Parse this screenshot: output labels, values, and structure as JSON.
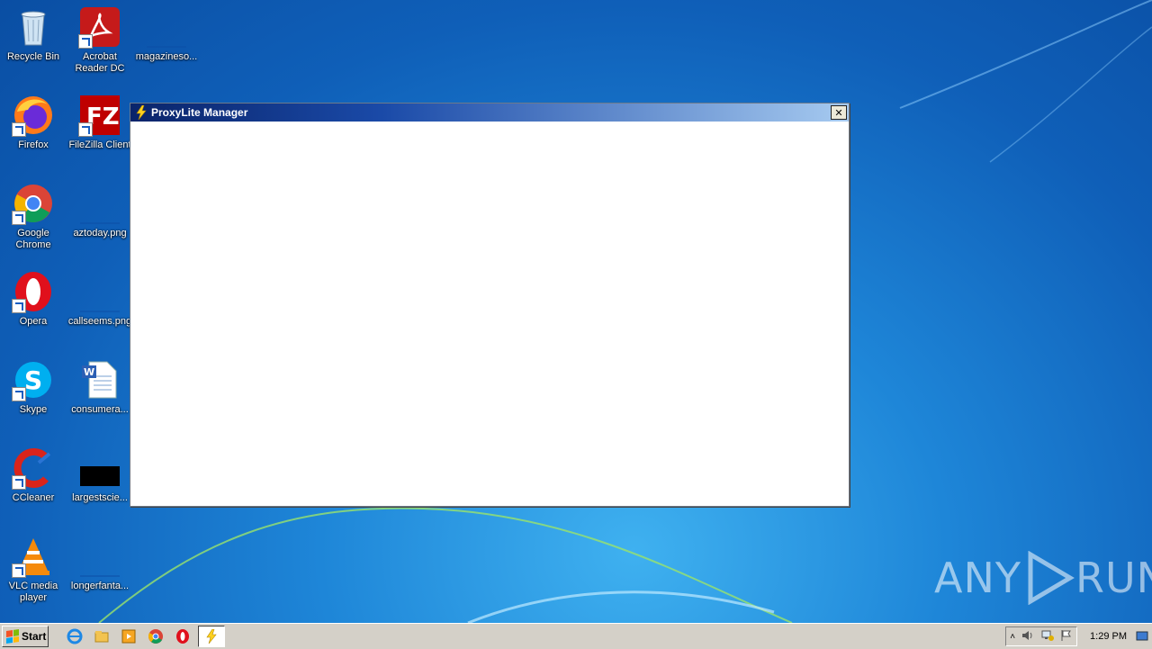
{
  "desktop": {
    "icons": [
      {
        "label": "Recycle Bin"
      },
      {
        "label": "Acrobat Reader DC"
      },
      {
        "label": "magazineso..."
      },
      {
        "label": "Firefox"
      },
      {
        "label": "FileZilla Client"
      },
      {
        "label": "Google Chrome"
      },
      {
        "label": "aztoday.png"
      },
      {
        "label": "Opera"
      },
      {
        "label": "callseems.png"
      },
      {
        "label": "Skype"
      },
      {
        "label": "consumera..."
      },
      {
        "label": "CCleaner"
      },
      {
        "label": "largestscie..."
      },
      {
        "label": "VLC media player"
      },
      {
        "label": "longerfanta..."
      }
    ]
  },
  "window": {
    "title": "ProxyLite Manager",
    "close_label": "✕"
  },
  "taskbar": {
    "start_label": "Start",
    "pinned": [
      "internet-explorer-icon",
      "explorer-icon",
      "media-player-icon",
      "chrome-icon",
      "opera-icon",
      "proxylite-icon"
    ],
    "clock": "1:29 PM"
  },
  "watermark": {
    "text_left": "ANY",
    "text_right": "RUN"
  },
  "colors": {
    "title_start": "#0a246a",
    "title_end": "#a6caf0",
    "taskbar": "#d4d0c8"
  }
}
